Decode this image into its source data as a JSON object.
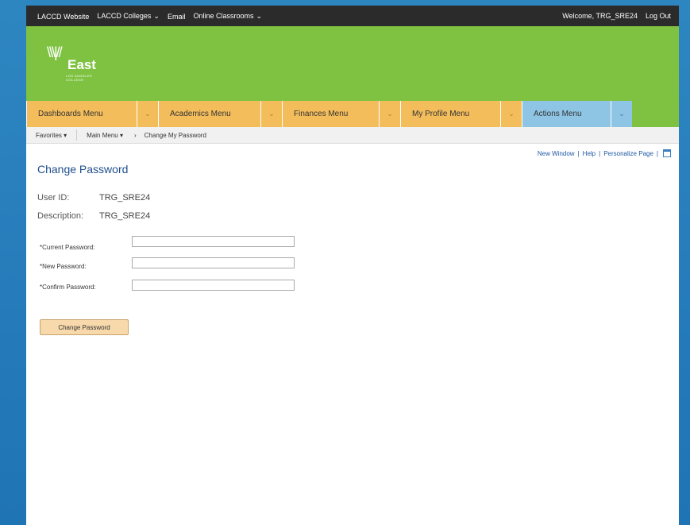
{
  "topbar": {
    "links": [
      "LACCD Website",
      "LACCD Colleges",
      "Email",
      "Online Classrooms"
    ],
    "welcome": "Welcome, TRG_SRE24",
    "logout": "Log Out"
  },
  "logo": {
    "name": "East",
    "subtitle": "LOS ANGELES COLLEGE"
  },
  "nav": {
    "tabs": [
      "Dashboards Menu",
      "Academics Menu",
      "Finances Menu",
      "My Profile Menu",
      "Actions Menu"
    ]
  },
  "breadcrumb": {
    "favorites": "Favorites",
    "main_menu": "Main Menu",
    "current": "Change My Password"
  },
  "utility": {
    "new_window": "New Window",
    "help": "Help",
    "personalize": "Personalize Page"
  },
  "page": {
    "title": "Change Password",
    "user_id_label": "User ID:",
    "user_id": "TRG_SRE24",
    "description_label": "Description:",
    "description": "TRG_SRE24"
  },
  "form": {
    "current_label": "*Current Password:",
    "new_label": "*New Password:",
    "confirm_label": "*Confirm Password:",
    "submit": "Change Password"
  },
  "colors": {
    "topbar": "#2b2b2b",
    "green": "#7fc242",
    "tab": "#f4bd5b",
    "tab_active": "#8ec4e4",
    "link": "#1f57a4",
    "title": "#1f4e8c"
  }
}
